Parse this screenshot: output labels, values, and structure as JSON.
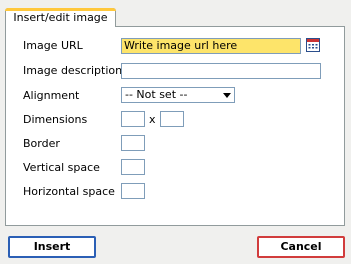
{
  "tab": {
    "label": "Insert/edit image"
  },
  "form": {
    "image_url": {
      "label": "Image URL",
      "value": "Write image url here"
    },
    "image_description": {
      "label": "Image description",
      "value": ""
    },
    "alignment": {
      "label": "Alignment",
      "selected": "-- Not set --"
    },
    "dimensions": {
      "label": "Dimensions",
      "separator": "x",
      "width": "",
      "height": ""
    },
    "border": {
      "label": "Border",
      "value": ""
    },
    "vertical_space": {
      "label": "Vertical space",
      "value": ""
    },
    "horizontal_space": {
      "label": "Horizontal space",
      "value": ""
    }
  },
  "buttons": {
    "insert": "Insert",
    "cancel": "Cancel"
  },
  "icons": {
    "browse": "file-browser-icon",
    "dropdown": "chevron-down-icon"
  },
  "colors": {
    "url_highlight": "#fde46a",
    "insert_border": "#2b5fb5",
    "cancel_border": "#d13c3c",
    "tab_accent": "#ffc83c"
  }
}
